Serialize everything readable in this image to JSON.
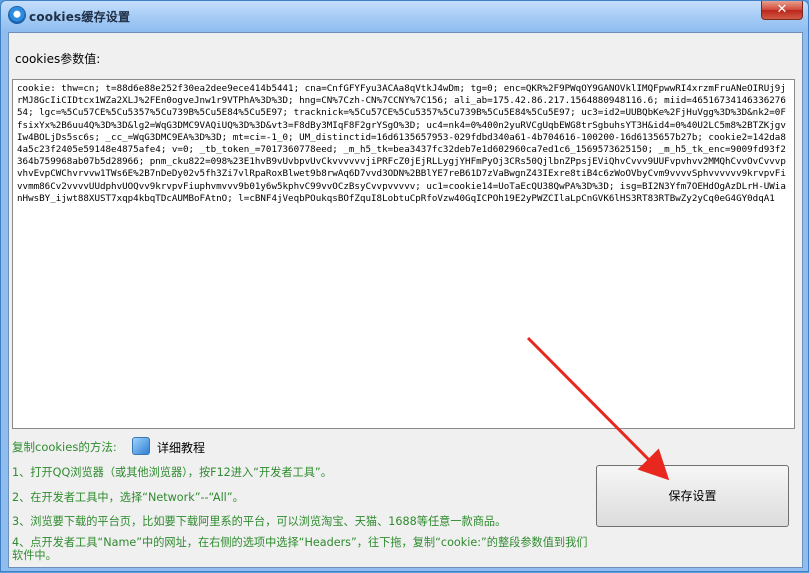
{
  "window": {
    "title": "cookies缓存设置",
    "close_label": "✕"
  },
  "param_label": "cookies参数值:",
  "cookie_value": "cookie: thw=cn; t=88d6e88e252f30ea2dee9ece414b5441; cna=CnfGFYFyu3ACAa8qVtkJ4wDm; tg=0; enc=QKR%2F9PWqOY9GANOVklIMQFpwwRI4xrzmFruANeOIRUj9jrMJ8GcIiCIDtcx1WZa2XLJ%2FEn0ogveJnw1r9VTPhA%3D%3D; hng=CN%7Czh-CN%7CCNY%7C156; ali_ab=175.42.86.217.1564880948116.6; miid=4651673414633627654; lgc=%5Cu57CE%5Cu5357%5Cu739B%5Cu5E84%5Cu5E97; tracknick=%5Cu57CE%5Cu5357%5Cu739B%5Cu5E84%5Cu5E97; uc3=id2=UUBQbKe%2FjHuVgg%3D%3D&nk2=0FfsixYx%2B6uu4Q%3D%3D&lg2=WqG3DMC9VAQiUQ%3D%3D&vt3=F8dBy3MIqF8F2grYSgO%3D; uc4=nk4=0%400n2yuRVCgUqbEWG8trSgbuhsYT3H&id4=0%40U2LC5m8%2BTZKjgvIw4BOLjDs5sc6s; _cc_=WqG3DMC9EA%3D%3D; mt=ci=-1_0; UM_distinctid=16d6135657953-029fdbd340a61-4b704616-100200-16d6135657b27b; cookie2=142da84a5c23f2405e59148e4875afe4; v=0; _tb_token_=7017360778eed; _m_h5_tk=bea3437fc32deb7e1d602960ca7ed1c6_1569573625150; _m_h5_tk_enc=9009fd93f2364b759968ab07b5d28966; pnm_cku822=098%23E1hvB9vUvbpvUvCkvvvvvvjiPRFcZ0jEjRLLygjYHFmPyOj3CRs50QjlbnZPpsjEViQhvCvvv9UUFvpvhvv2MMQhCvvOvCvvvpvhvEvpCWChvrvvw1TWs6E%2B7nDeDy02v5fh3Zi7vlRpaRoxBlwet9b8rwAq6D7vvd3ODN%2BBlYE7reB61D7zVaBwgnZ43IExre8tiB4c6zWoOVbyCvm9vvvvSphvvvvvv9krvpvFivvmm86Cv2vvvvUUdphvUOQvv9krvpvFiuphvmvvv9b01y6w5kphvC99vvOCzBsyCvvpvvvvv; uc1=cookie14=UoTaEcQU38QwPA%3D%3D; isg=BI2N3Yfm7OEHdOgAzDLrH-UWianHwsBY_ijwt88XUST7xqp4kbqTDcAUMBoFAtnO; l=cBNF4jVeqbPOukqsBOfZquI8LobtuCpRfoVzw40GqICPOh19E2yPWZCIlaLpCnGVK6lHS3RT83RTBwZy2yCq0eG4GY0dqA1",
  "howto": {
    "label": "复制cookies的方法:",
    "tutorial_label": "详细教程"
  },
  "steps": [
    "1、打开QQ浏览器（或其他浏览器），按F12进入“开发者工具”。",
    "2、在开发者工具中，选择“Network”--“All”。",
    "3、浏览要下载的平台页，比如要下载阿里系的平台，可以浏览淘宝、天猫、1688等任意一款商品。",
    "4、点开发者工具“Name”中的网址，在右侧的选项中选择“Headers”，往下拖，复制“cookie:”的整段参数值到我们软件中。"
  ],
  "save_button_label": "保存设置",
  "colors": {
    "step_text": "#2e8b2e",
    "arrow": "#e8281e"
  }
}
